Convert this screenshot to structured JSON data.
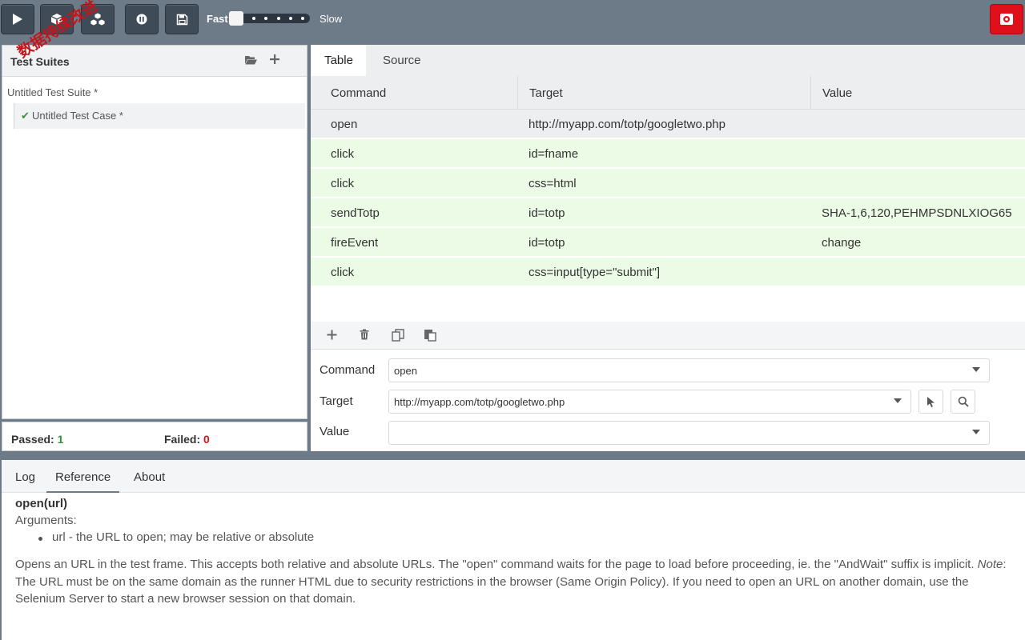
{
  "toolbar": {
    "buttons": [
      {
        "name": "run-all-button",
        "icon": "play-icon"
      },
      {
        "name": "run-current-button",
        "icon": "cube-icon"
      },
      {
        "name": "run-suite-button",
        "icon": "cubes-icon"
      },
      {
        "name": "pause-button",
        "icon": "pause-icon"
      },
      {
        "name": "save-button",
        "icon": "floppy-icon"
      }
    ],
    "speed": {
      "fast_label": "Fast",
      "slow_label": "Slow",
      "level": 0
    },
    "record_icon": "record-icon",
    "record_color": "#e0101b"
  },
  "suites": {
    "title": "Test Suites",
    "suite_name": "Untitled Test Suite *",
    "case_check": "✔",
    "case_name": "Untitled Test Case *",
    "watermark": "数据持续改进"
  },
  "stats": {
    "passed_label": "Passed:",
    "passed_count": "1",
    "failed_label": "Failed:",
    "failed_count": "0"
  },
  "editor": {
    "tabs": [
      "Table",
      "Source"
    ],
    "columns": [
      "Command",
      "Target",
      "Value"
    ],
    "rows": [
      {
        "command": "open",
        "target": "http://myapp.com/totp/googletwo.php",
        "value": ""
      },
      {
        "command": "click",
        "target": "id=fname",
        "value": ""
      },
      {
        "command": "click",
        "target": "css=html",
        "value": ""
      },
      {
        "command": "sendTotp",
        "target": "id=totp",
        "value": "SHA-1,6,120,PEHMPSDNLXIOG65"
      },
      {
        "command": "fireEvent",
        "target": "id=totp",
        "value": "change"
      },
      {
        "command": "click",
        "target": "css=input[type=\"submit\"]",
        "value": ""
      }
    ],
    "form": {
      "command_label": "Command",
      "command_value": "open",
      "target_label": "Target",
      "target_value": "http://myapp.com/totp/googletwo.php",
      "value_label": "Value",
      "value_value": ""
    },
    "colors": {
      "passed_row": "#ecfbe5",
      "selected_row": "#eceef0"
    }
  },
  "bottom": {
    "tabs": [
      "Log",
      "Reference",
      "About"
    ],
    "active_tab": "Reference",
    "signature": "open(url)",
    "args_label": "Arguments:",
    "arg_item": "url - the URL to open; may be relative or absolute",
    "desc_1": "Opens an URL in the test frame. This accepts both relative and absolute URLs. The \"open\" command waits for the page to load before proceeding, ie. the \"AndWait\" suffix is implicit.",
    "desc_note": "Note",
    "desc_2": ": The URL must be on the same domain as the runner HTML due to security restrictions in the browser (Same Origin Policy). If you need to open an URL on another domain, use the Selenium Server to start a new browser session on that domain."
  }
}
